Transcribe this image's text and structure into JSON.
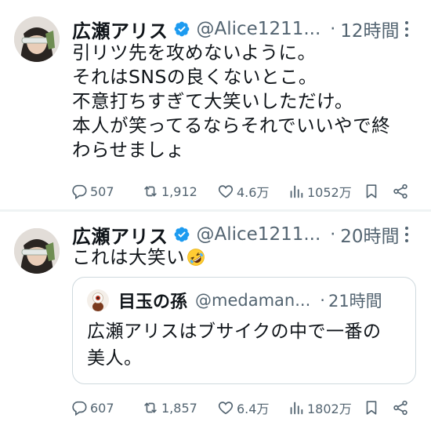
{
  "tweets": [
    {
      "author_name": "広瀬アリス",
      "handle": "@Alice1211...",
      "separator": "·",
      "time": "12時間",
      "text": "引リツ先を攻めないように。\nそれはSNSの良くないとこ。\n不意打ちすぎて大笑いしただけ。\n本人が笑ってるならそれでいいやで終\nわらせましょ",
      "replies": "507",
      "retweets": "1,912",
      "likes": "4.6万",
      "views": "1052万"
    },
    {
      "author_name": "広瀬アリス",
      "handle": "@Alice1211...",
      "separator": "·",
      "time": "20時間",
      "text": "これは大笑い",
      "text_emoji": "rolling-on-floor-laughing-emoji",
      "quote": {
        "author_name": "目玉の孫",
        "handle": "@medaman...",
        "separator": "·",
        "time": "21時間",
        "text": "広瀬アリスはブサイクの中で一番の\n美人。"
      },
      "replies": "607",
      "retweets": "1,857",
      "likes": "6.4万",
      "views": "1802万"
    }
  ],
  "colors": {
    "text": "#0f1419",
    "secondary": "#536471",
    "verified_blue": "#1d9bf0",
    "border": "#cfd9de"
  }
}
